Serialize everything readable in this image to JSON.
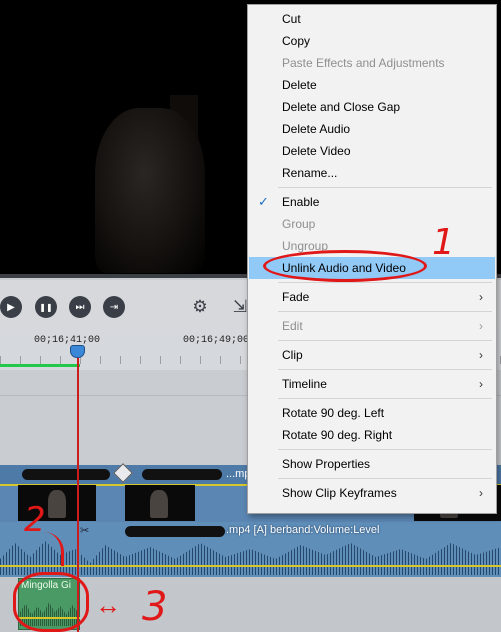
{
  "timeline": {
    "ruler": {
      "tick_1": "00;16;41;00",
      "tick_2": "00;16;49;00"
    },
    "video_clip_title": "...mp4",
    "audio_clip_title": ".mp4 [A] berband:Volume:Level",
    "bottom_clip_label": "Mingolla Gi"
  },
  "transport": {
    "play_icon": "▶",
    "pause_icon": "❚❚",
    "next_icon": "⏭",
    "end_icon": "⇥",
    "preview_settings_icon": "⚙",
    "export_icon": "⇲"
  },
  "context_menu": {
    "items": [
      {
        "label": "Cut",
        "enabled": true
      },
      {
        "label": "Copy",
        "enabled": true
      },
      {
        "label": "Paste Effects and Adjustments",
        "enabled": false
      },
      {
        "label": "Delete",
        "enabled": true
      },
      {
        "label": "Delete and Close Gap",
        "enabled": true
      },
      {
        "label": "Delete Audio",
        "enabled": true
      },
      {
        "label": "Delete Video",
        "enabled": true
      },
      {
        "label": "Rename...",
        "enabled": true
      },
      {
        "label": "Enable",
        "enabled": true,
        "checked": true
      },
      {
        "label": "Group",
        "enabled": false
      },
      {
        "label": "Ungroup",
        "enabled": false
      },
      {
        "label": "Unlink Audio and Video",
        "enabled": true,
        "highlighted": true
      },
      {
        "label": "Fade",
        "enabled": true,
        "submenu": true
      },
      {
        "label": "Edit",
        "enabled": false,
        "submenu": true
      },
      {
        "label": "Clip",
        "enabled": true,
        "submenu": true
      },
      {
        "label": "Timeline",
        "enabled": true,
        "submenu": true
      },
      {
        "label": "Rotate 90 deg. Left",
        "enabled": true
      },
      {
        "label": "Rotate 90 deg. Right",
        "enabled": true
      },
      {
        "label": "Show Properties",
        "enabled": true
      },
      {
        "label": "Show Clip Keyframes",
        "enabled": true,
        "submenu": true
      }
    ],
    "checkmark": "✓",
    "submenu_arrow": "›"
  },
  "annotations": {
    "label_1": "1",
    "label_2": "2",
    "label_3": "3",
    "arrow": "↔"
  },
  "colors": {
    "highlight": "#91c9f7",
    "annotation_red": "#e01818",
    "playhead": "#cc1c1c",
    "video_clip": "#5b86b3",
    "audio_clip": "#5f8eb9",
    "bottom_clip": "#4a9a66"
  }
}
